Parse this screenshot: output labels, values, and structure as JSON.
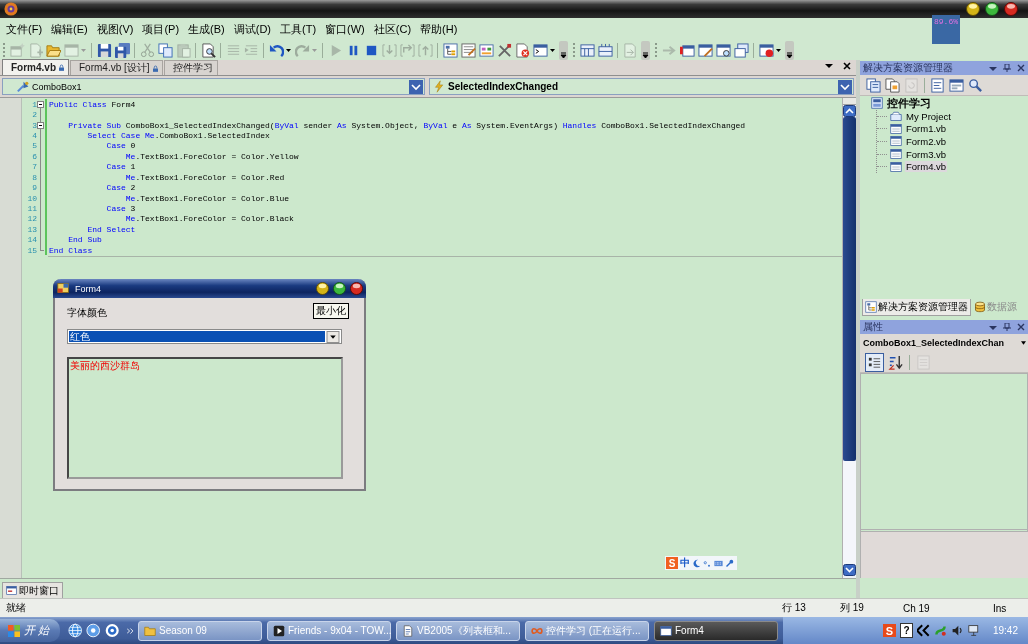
{
  "menu": [
    "文件(F)",
    "编辑(E)",
    "视图(V)",
    "项目(P)",
    "生成(B)",
    "调试(D)",
    "工具(T)",
    "窗口(W)",
    "社区(C)",
    "帮助(H)"
  ],
  "toolbars": [
    {
      "groups": [
        [
          {
            "kind": "new-project",
            "disabled": true,
            "dropdown": false
          },
          {
            "kind": "add-item",
            "disabled": true,
            "dropdown": false
          },
          {
            "kind": "open",
            "disabled": false,
            "dropdown": false
          },
          {
            "kind": "add-existing",
            "disabled": true,
            "dropdown": true
          }
        ],
        [
          {
            "kind": "save",
            "disabled": false,
            "dropdown": false
          },
          {
            "kind": "save-all",
            "disabled": false,
            "dropdown": false
          }
        ],
        [
          {
            "kind": "cut",
            "disabled": true,
            "dropdown": false
          },
          {
            "kind": "copy",
            "disabled": false,
            "dropdown": false
          },
          {
            "kind": "paste",
            "disabled": true,
            "dropdown": false
          }
        ],
        [
          {
            "kind": "find",
            "disabled": false,
            "dropdown": false
          }
        ],
        [
          {
            "kind": "comment",
            "disabled": true,
            "dropdown": false
          },
          {
            "kind": "uncomment",
            "disabled": true,
            "dropdown": false
          }
        ],
        [
          {
            "kind": "undo",
            "disabled": false,
            "dropdown": true
          },
          {
            "kind": "redo",
            "disabled": true,
            "dropdown": true
          }
        ],
        [
          {
            "kind": "start",
            "disabled": true,
            "dropdown": false
          },
          {
            "kind": "pause",
            "disabled": false,
            "dropdown": false
          },
          {
            "kind": "stop",
            "disabled": false,
            "dropdown": false
          },
          {
            "kind": "step-into",
            "disabled": true,
            "dropdown": false
          },
          {
            "kind": "step-over",
            "disabled": true,
            "dropdown": false
          },
          {
            "kind": "step-out",
            "disabled": true,
            "dropdown": false
          }
        ],
        [
          {
            "kind": "solution-explorer",
            "disabled": false,
            "dropdown": false
          },
          {
            "kind": "properties",
            "disabled": false,
            "dropdown": false
          },
          {
            "kind": "object-browser",
            "disabled": false,
            "dropdown": false
          },
          {
            "kind": "toolbox",
            "disabled": false,
            "dropdown": false
          },
          {
            "kind": "error-list",
            "disabled": false,
            "dropdown": false
          },
          {
            "kind": "command-window",
            "disabled": false,
            "dropdown": true
          }
        ]
      ]
    },
    {
      "groups": [
        [
          {
            "kind": "grid-panel",
            "disabled": false,
            "dropdown": false
          },
          {
            "kind": "column-panel",
            "disabled": false,
            "dropdown": false
          }
        ],
        [
          {
            "kind": "document-arrow",
            "disabled": true,
            "dropdown": false
          }
        ]
      ]
    },
    {
      "groups": [
        [
          {
            "kind": "right-arrow",
            "disabled": true,
            "dropdown": false
          },
          {
            "kind": "window-alert",
            "disabled": false,
            "dropdown": false
          },
          {
            "kind": "window-pencil",
            "disabled": false,
            "dropdown": false
          },
          {
            "kind": "window-search",
            "disabled": false,
            "dropdown": false
          },
          {
            "kind": "windows-stack",
            "disabled": false,
            "dropdown": false
          }
        ],
        [
          {
            "kind": "window-record",
            "disabled": false,
            "dropdown": true
          }
        ]
      ]
    }
  ],
  "usage_meter": {
    "reading": "89.6%"
  },
  "editor": {
    "tabs": [
      {
        "label": "Form4.vb",
        "selected": true,
        "locked": true
      },
      {
        "label": "Form4.vb [设计]",
        "selected": false,
        "locked": true
      },
      {
        "label": "控件学习",
        "selected": false,
        "locked": false
      }
    ],
    "class_dropdown": "ComboBox1",
    "method_dropdown": "SelectedIndexChanged",
    "lines": [
      {
        "number": "1",
        "collapsible": true,
        "tokens": [
          {
            "text": "Public Class",
            "kind": "keyword"
          },
          {
            "text": " Form4",
            "kind": "plain"
          }
        ]
      },
      {
        "number": "2",
        "collapsible": false
      },
      {
        "number": "3",
        "collapsible": true,
        "tokens": [
          {
            "text": "    Private Sub",
            "kind": "keyword"
          },
          {
            "text": " ComboBox1_SelectedIndexChanged(",
            "kind": "plain"
          },
          {
            "text": "ByVal",
            "kind": "keyword"
          },
          {
            "text": " sender ",
            "kind": "plain"
          },
          {
            "text": "As",
            "kind": "keyword"
          },
          {
            "text": " System.Object, ",
            "kind": "plain"
          },
          {
            "text": "ByVal",
            "kind": "keyword"
          },
          {
            "text": " e ",
            "kind": "plain"
          },
          {
            "text": "As",
            "kind": "keyword"
          },
          {
            "text": " System.EventArgs) ",
            "kind": "plain"
          },
          {
            "text": "Handles",
            "kind": "keyword"
          },
          {
            "text": " ComboBox1.SelectedIndexChanged",
            "kind": "plain"
          }
        ]
      },
      {
        "number": "4",
        "collapsible": false,
        "tokens": [
          {
            "text": "        Select Case Me",
            "kind": "keyword"
          },
          {
            "text": ".ComboBox1.SelectedIndex",
            "kind": "plain"
          }
        ]
      },
      {
        "number": "5",
        "collapsible": false,
        "tokens": [
          {
            "text": "            Case",
            "kind": "keyword"
          },
          {
            "text": " 0",
            "kind": "plain"
          }
        ]
      },
      {
        "number": "6",
        "collapsible": false,
        "tokens": [
          {
            "text": "                Me",
            "kind": "keyword"
          },
          {
            "text": ".TextBox1.ForeColor = Color.Yellow",
            "kind": "plain"
          }
        ]
      },
      {
        "number": "7",
        "collapsible": false,
        "tokens": [
          {
            "text": "            Case",
            "kind": "keyword"
          },
          {
            "text": " 1",
            "kind": "plain"
          }
        ]
      },
      {
        "number": "8",
        "collapsible": false,
        "tokens": [
          {
            "text": "                Me",
            "kind": "keyword"
          },
          {
            "text": ".TextBox1.ForeColor = Color.Red",
            "kind": "plain"
          }
        ]
      },
      {
        "number": "9",
        "collapsible": false,
        "tokens": [
          {
            "text": "            Case",
            "kind": "keyword"
          },
          {
            "text": " 2",
            "kind": "plain"
          }
        ]
      },
      {
        "number": "10",
        "collapsible": false,
        "tokens": [
          {
            "text": "                Me",
            "kind": "keyword"
          },
          {
            "text": ".TextBox1.ForeColor = Color.Blue",
            "kind": "plain"
          }
        ]
      },
      {
        "number": "11",
        "collapsible": false,
        "tokens": [
          {
            "text": "            Case",
            "kind": "keyword"
          },
          {
            "text": " 3",
            "kind": "plain"
          }
        ]
      },
      {
        "number": "12",
        "collapsible": false,
        "tokens": [
          {
            "text": "                Me",
            "kind": "keyword"
          },
          {
            "text": ".TextBox1.ForeColor = Color.Black",
            "kind": "plain"
          }
        ]
      },
      {
        "number": "13",
        "collapsible": false,
        "tokens": [
          {
            "text": "        End Select",
            "kind": "keyword"
          }
        ]
      },
      {
        "number": "14",
        "collapsible": false,
        "tokens": [
          {
            "text": "    End Sub",
            "kind": "keyword"
          }
        ]
      },
      {
        "number": "15",
        "collapsible": false,
        "tokens": [
          {
            "text": "End Class",
            "kind": "keyword"
          }
        ]
      }
    ]
  },
  "form_window": {
    "title": "Form4",
    "tooltip": "最小化",
    "label": "字体颜色",
    "combo": {
      "value": "红色"
    },
    "text_box": {
      "value": "美丽的西沙群岛"
    }
  },
  "ime_bar": {
    "logo": "S",
    "mode": "中"
  },
  "immediate_window_tab": "即时窗口",
  "solution_explorer": {
    "title": "解决方案资源管理器",
    "tool_groups": [
      [
        {
          "kind": "properties-page",
          "disabled": false
        },
        {
          "kind": "show-all",
          "disabled": false
        },
        {
          "kind": "refresh",
          "disabled": true
        }
      ],
      [
        {
          "kind": "view-code",
          "disabled": false
        },
        {
          "kind": "view-designer",
          "disabled": false
        },
        {
          "kind": "class-diagram",
          "disabled": false
        }
      ]
    ],
    "tree": [
      {
        "label": "控件学习",
        "kind": "project",
        "selected": false,
        "children": [
          {
            "label": "My Project",
            "kind": "my-project",
            "selected": false
          },
          {
            "label": "Form1.vb",
            "kind": "form",
            "selected": false
          },
          {
            "label": "Form2.vb",
            "kind": "form",
            "selected": false
          },
          {
            "label": "Form3.vb",
            "kind": "form",
            "selected": false
          },
          {
            "label": "Form4.vb",
            "kind": "form",
            "selected": true
          }
        ]
      }
    ]
  },
  "panel_tabs": [
    {
      "label": "解决方案资源管理器",
      "kind": "solution",
      "selected": true
    },
    {
      "label": "数据源",
      "kind": "data",
      "selected": false
    }
  ],
  "properties": {
    "title": "属性",
    "object": "ComboBox1_SelectedIndexChan",
    "tool_groups": [
      [
        {
          "kind": "categorized",
          "selected": true,
          "disabled": false
        },
        {
          "kind": "alphabetical",
          "selected": false,
          "disabled": false
        }
      ],
      [
        {
          "kind": "property-pages",
          "selected": false,
          "disabled": true
        }
      ]
    ]
  },
  "status_bar": {
    "message": "就绪",
    "line": "行 13",
    "column": "列 19",
    "char": "Ch 19",
    "mode": "Ins"
  },
  "taskbar": {
    "start": "开 始",
    "tasks": [
      {
        "label": "Season 09",
        "kind": "folder",
        "selected": false
      },
      {
        "label": "Friends - 9x04 - TOW...",
        "kind": "player",
        "selected": false
      },
      {
        "label": "VB2005《列表框和...",
        "kind": "document",
        "selected": false
      },
      {
        "label": "控件学习 (正在运行...",
        "kind": "program",
        "selected": false
      },
      {
        "label": "Form4",
        "kind": "window",
        "selected": true
      }
    ],
    "tray": {
      "ime_logo": "S",
      "help": "?",
      "clock": "19:42"
    }
  }
}
